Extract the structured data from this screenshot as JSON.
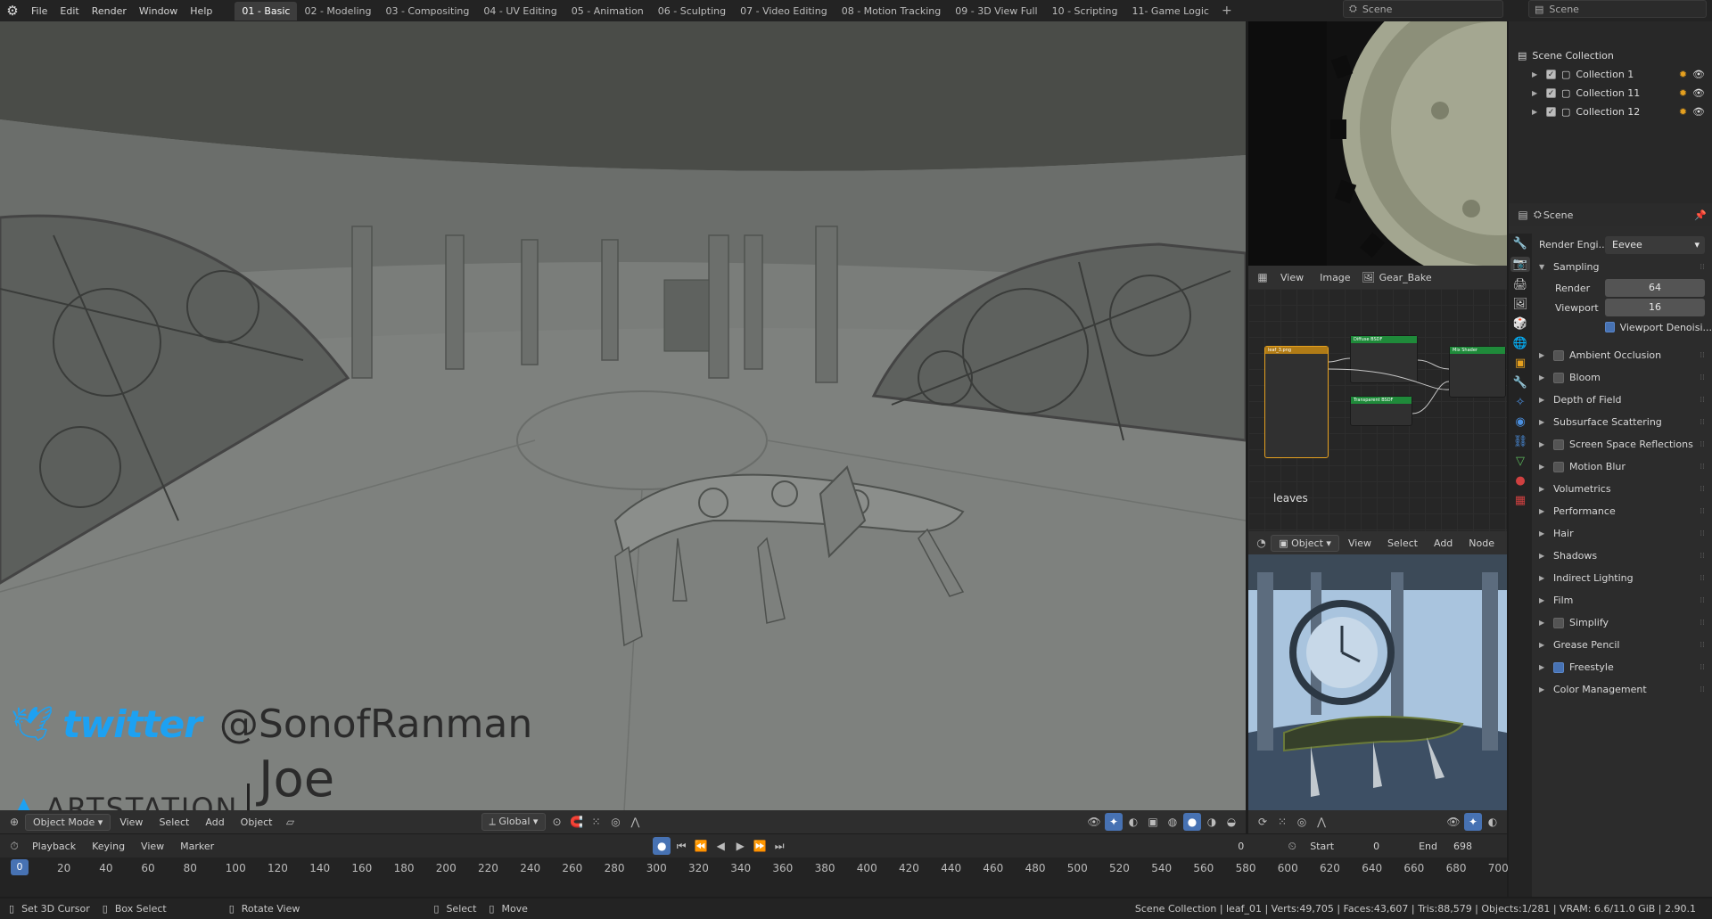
{
  "topbar": {
    "menus": [
      "File",
      "Edit",
      "Render",
      "Window",
      "Help"
    ],
    "workspaces": [
      "01 - Basic",
      "02 - Modeling",
      "03 - Compositing",
      "04 - UV Editing",
      "05 - Animation",
      "06 - Sculpting",
      "07 - Video Editing",
      "08 - Motion Tracking",
      "09 - 3D View Full",
      "10 - Scripting",
      "11- Game Logic"
    ],
    "active_workspace": "01 - Basic",
    "scene_label": "Scene",
    "scene_label_2": "Scene"
  },
  "viewport": {
    "mode": "Object Mode",
    "menus": [
      "View",
      "Select",
      "Add",
      "Object"
    ],
    "orientation": "Global",
    "overlay_twitter_word": "twitter",
    "overlay_handle": "@SonofRanman",
    "overlay_artstation": "ARTSTATION",
    "overlay_name": "Joe Rannells"
  },
  "image_editor": {
    "menus": [
      "View",
      "Image"
    ],
    "image_name": "Gear_Bake"
  },
  "node_editor": {
    "label": "leaves",
    "nodes": [
      "leaf_3.png",
      "Diffuse BSDF",
      "Mix Shader",
      "Transparent BSDF"
    ]
  },
  "render_view": {
    "mode": "Object",
    "menus": [
      "View",
      "Select",
      "Add",
      "Node"
    ]
  },
  "outliner": {
    "root": "Scene Collection",
    "items": [
      "Collection 1",
      "Collection 11",
      "Collection 12"
    ]
  },
  "properties": {
    "scene": "Scene",
    "render_engine_label": "Render Engi...",
    "render_engine": "Eevee",
    "sampling_label": "Sampling",
    "render_label": "Render",
    "render_value": "64",
    "viewport_label": "Viewport",
    "viewport_value": "16",
    "denoise_label": "Viewport Denoisi...",
    "panels": [
      {
        "label": "Ambient Occlusion",
        "checkbox": true,
        "checked": false
      },
      {
        "label": "Bloom",
        "checkbox": true,
        "checked": false
      },
      {
        "label": "Depth of Field",
        "checkbox": false
      },
      {
        "label": "Subsurface Scattering",
        "checkbox": false
      },
      {
        "label": "Screen Space Reflections",
        "checkbox": true,
        "checked": false
      },
      {
        "label": "Motion Blur",
        "checkbox": true,
        "checked": false
      },
      {
        "label": "Volumetrics",
        "checkbox": false
      },
      {
        "label": "Performance",
        "checkbox": false
      },
      {
        "label": "Hair",
        "checkbox": false
      },
      {
        "label": "Shadows",
        "checkbox": false
      },
      {
        "label": "Indirect Lighting",
        "checkbox": false
      },
      {
        "label": "Film",
        "checkbox": false
      },
      {
        "label": "Simplify",
        "checkbox": true,
        "checked": false
      },
      {
        "label": "Grease Pencil",
        "checkbox": false
      },
      {
        "label": "Freestyle",
        "checkbox": true,
        "checked": true
      },
      {
        "label": "Color Management",
        "checkbox": false
      }
    ]
  },
  "timeline": {
    "menus": [
      "Playback",
      "Keying",
      "View",
      "Marker"
    ],
    "current_frame": "0",
    "start_label": "Start",
    "start": "0",
    "end_label": "End",
    "end": "698",
    "frame_marker": "0",
    "ticks": [
      "20",
      "40",
      "60",
      "80",
      "100",
      "120",
      "140",
      "160",
      "180",
      "200",
      "220",
      "240",
      "260",
      "280",
      "300",
      "320",
      "340",
      "360",
      "380",
      "400",
      "420",
      "440",
      "460",
      "480",
      "500",
      "520",
      "540",
      "560",
      "580",
      "600",
      "620",
      "640",
      "660",
      "680",
      "700"
    ]
  },
  "statusbar": {
    "hint1": "Set 3D Cursor",
    "hint2": "Box Select",
    "hint3": "Rotate View",
    "hint4": "Select",
    "hint5": "Move",
    "info": "Scene Collection | leaf_01 | Verts:49,705 | Faces:43,607 | Tris:88,579 | Objects:1/281 | VRAM: 6.6/11.0 GiB | 2.90.1"
  },
  "colors": {
    "accent": "#4772b3",
    "twitter": "#1da1f2",
    "node_green": "#1f8a3a"
  }
}
